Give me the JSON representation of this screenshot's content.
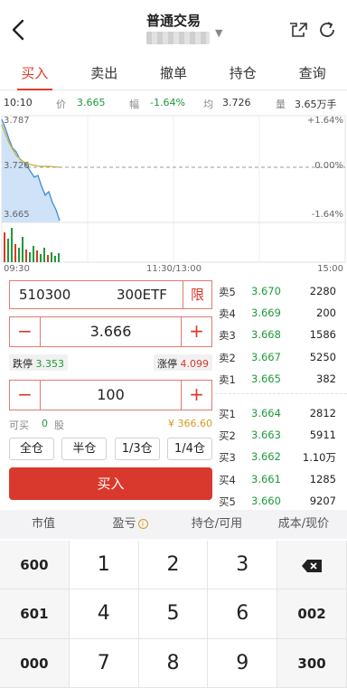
{
  "header": {
    "title": "普通交易"
  },
  "tabs": [
    {
      "label": "买入",
      "active": true
    },
    {
      "label": "卖出",
      "active": false
    },
    {
      "label": "撤单",
      "active": false
    },
    {
      "label": "持仓",
      "active": false
    },
    {
      "label": "查询",
      "active": false
    }
  ],
  "quote": {
    "time": "10:10",
    "price_label": "价",
    "price": "3.665",
    "change_label": "幅",
    "change": "-1.64%",
    "avg_label": "均",
    "avg": "3.726",
    "volume_label": "量",
    "volume": "3.65万手"
  },
  "chart": {
    "price_high": "3.787",
    "price_mid": "3.726",
    "price_low": "3.665",
    "pct_high": "+1.64%",
    "pct_mid": "0.00%",
    "pct_low": "-1.64%",
    "time_start": "09:30",
    "time_mid": "11:30/13:00",
    "time_end": "15:00",
    "colors": {
      "price_line": "#3a8fd8",
      "avg_line": "#c8b33a",
      "area": "#cfe2f7",
      "vol_up": "#d73a2c",
      "vol_down": "#1e9a3a"
    }
  },
  "order": {
    "code": "510300",
    "name": "300ETF",
    "limit_label": "限",
    "price": "3.666",
    "limit_down_label": "跌停",
    "limit_down": "3.353",
    "limit_up_label": "涨停",
    "limit_up": "4.099",
    "quantity": "100",
    "available_label": "可买",
    "available": "0",
    "available_unit": "股",
    "amount": "¥ 366.60",
    "ratio_buttons": [
      "全仓",
      "半仓",
      "1/3仓",
      "1/4仓"
    ],
    "buy_label": "买入"
  },
  "book": {
    "asks": [
      {
        "label": "卖5",
        "price": "3.670",
        "vol": "2280"
      },
      {
        "label": "卖4",
        "price": "3.669",
        "vol": "200"
      },
      {
        "label": "卖3",
        "price": "3.668",
        "vol": "1586"
      },
      {
        "label": "卖2",
        "price": "3.667",
        "vol": "5250"
      },
      {
        "label": "卖1",
        "price": "3.665",
        "vol": "382"
      }
    ],
    "bids": [
      {
        "label": "买1",
        "price": "3.664",
        "vol": "2812"
      },
      {
        "label": "买2",
        "price": "3.663",
        "vol": "5911"
      },
      {
        "label": "买3",
        "price": "3.662",
        "vol": "1.10万"
      },
      {
        "label": "买4",
        "price": "3.661",
        "vol": "1285"
      },
      {
        "label": "买5",
        "price": "3.660",
        "vol": "9207"
      }
    ]
  },
  "positions_header": {
    "market_value": "市值",
    "pnl": "盈亏",
    "holding": "持仓/可用",
    "cost": "成本/现价"
  },
  "keypad": {
    "keys": [
      "600",
      "1",
      "2",
      "3",
      "backspace",
      "601",
      "4",
      "5",
      "6",
      "002",
      "000",
      "7",
      "8",
      "9",
      "300"
    ]
  }
}
